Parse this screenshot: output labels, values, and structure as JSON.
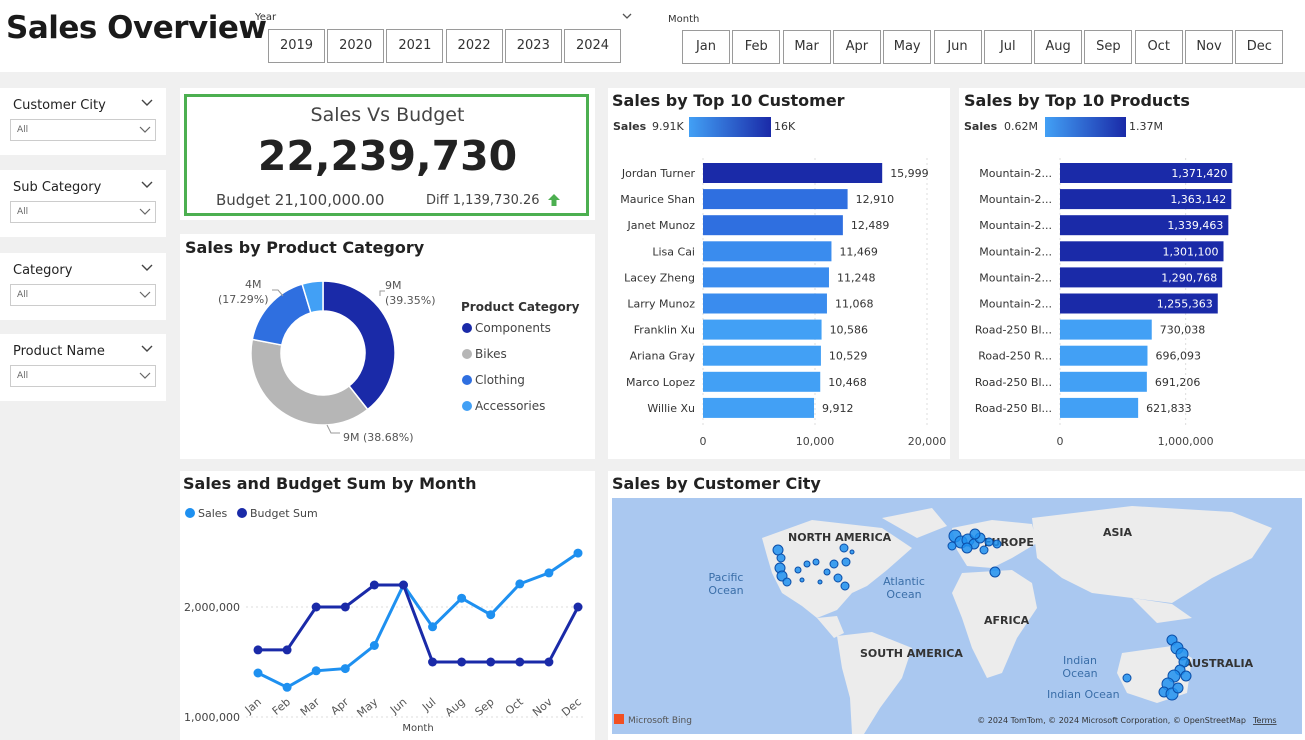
{
  "header": {
    "title": "Sales Overview"
  },
  "year_slicer": {
    "label": "Year",
    "options": [
      "2019",
      "2020",
      "2021",
      "2022",
      "2023",
      "2024"
    ]
  },
  "month_slicer": {
    "label": "Month",
    "options": [
      "Jan",
      "Feb",
      "Mar",
      "Apr",
      "May",
      "Jun",
      "Jul",
      "Aug",
      "Sep",
      "Oct",
      "Nov",
      "Dec"
    ]
  },
  "filters": [
    {
      "title": "Customer City",
      "value": "All"
    },
    {
      "title": "Sub Category",
      "value": "All"
    },
    {
      "title": "Category",
      "value": "All"
    },
    {
      "title": "Product Name",
      "value": "All"
    }
  ],
  "kpi": {
    "title": "Sales Vs Budget",
    "value": "22,239,730",
    "budget": "Budget 21,100,000.00",
    "diff": "Diff 1,139,730.26",
    "accent": "#4caf50"
  },
  "colors": {
    "dark_blue": "#1a2aa8",
    "mid_blue": "#2f6fe0",
    "light_blue": "#42a0f5",
    "grey": "#b6b6b6",
    "line_sales": "#1e90f0",
    "line_budget": "#1a2aa8"
  },
  "chart_data": [
    {
      "type": "pie",
      "title": "Sales by Product Category",
      "legend_title": "Product Category",
      "categories": [
        "Components",
        "Bikes",
        "Clothing",
        "Accessories"
      ],
      "values": [
        9,
        9,
        4,
        0.9
      ],
      "data_labels": [
        "9M\n(39.35%)",
        "9M (38.68%)",
        "4M\n(17.29%)",
        ""
      ],
      "percentages": [
        39.35,
        38.68,
        17.29,
        4.68
      ],
      "colors": [
        "#1a2aa8",
        "#b6b6b6",
        "#2f6fe0",
        "#42a0f5"
      ],
      "legend_position": "right"
    },
    {
      "type": "bar",
      "title": "Sales by Top 10 Customer",
      "gradient_label": "Sales",
      "gradient_min": "9.91K",
      "gradient_max": "16K",
      "categories": [
        "Jordan Turner",
        "Maurice Shan",
        "Janet Munoz",
        "Lisa Cai",
        "Lacey Zheng",
        "Larry Munoz",
        "Franklin Xu",
        "Ariana Gray",
        "Marco Lopez",
        "Willie Xu"
      ],
      "values": [
        15999,
        12910,
        12489,
        11469,
        11248,
        11068,
        10586,
        10529,
        10468,
        9912
      ],
      "value_labels": [
        "15,999",
        "12,910",
        "12,489",
        "11,469",
        "11,248",
        "11,068",
        "10,586",
        "10,529",
        "10,468",
        "9,912"
      ],
      "xlim": [
        0,
        20000
      ],
      "x_ticks": [
        "0",
        "10,000",
        "20,000"
      ]
    },
    {
      "type": "bar",
      "title": "Sales by Top 10 Products",
      "gradient_label": "Sales",
      "gradient_min": "0.62M",
      "gradient_max": "1.37M",
      "categories": [
        "Mountain-2...",
        "Mountain-2...",
        "Mountain-2...",
        "Mountain-2...",
        "Mountain-2...",
        "Mountain-2...",
        "Road-250 Bl...",
        "Road-250 R...",
        "Road-250 Bl...",
        "Road-250 Bl..."
      ],
      "values": [
        1371420,
        1363142,
        1339463,
        1301100,
        1290768,
        1255363,
        730038,
        696093,
        691206,
        621833
      ],
      "value_labels": [
        "1,371,420",
        "1,363,142",
        "1,339,463",
        "1,301,100",
        "1,290,768",
        "1,255,363",
        "730,038",
        "696,093",
        "691,206",
        "621,833"
      ],
      "xlim": [
        0,
        1500000
      ],
      "x_ticks": [
        "0",
        "1,000,000"
      ]
    },
    {
      "type": "line",
      "title": "Sales and Budget Sum by Month",
      "xlabel": "Month",
      "categories": [
        "Jan",
        "Feb",
        "Mar",
        "Apr",
        "May",
        "Jun",
        "Jul",
        "Aug",
        "Sep",
        "Oct",
        "Nov",
        "Dec"
      ],
      "series": [
        {
          "name": "Sales",
          "values": [
            1400000,
            1270000,
            1420000,
            1440000,
            1650000,
            2200000,
            1820000,
            2080000,
            1930000,
            2210000,
            2310000,
            2490000
          ]
        },
        {
          "name": "Budget Sum",
          "values": [
            1610000,
            1610000,
            2000000,
            2000000,
            2200000,
            2200000,
            1500000,
            1500000,
            1500000,
            1500000,
            1500000,
            2000000
          ]
        }
      ],
      "ylim": [
        1000000,
        2600000
      ],
      "y_ticks": [
        "2,000,000",
        "1,000,000"
      ],
      "legend_position": "top-left"
    }
  ],
  "map": {
    "title": "Sales by Customer City",
    "labels": [
      "NORTH AMERICA",
      "EUROPE",
      "ASIA",
      "Pacific Ocean",
      "Atlantic Ocean",
      "AFRICA",
      "SOUTH AMERICA",
      "Indian Ocean",
      "Indian Ocean",
      "AUSTRALIA"
    ],
    "bing": "Microsoft Bing",
    "copyright": "© 2024 TomTom, © 2024 Microsoft Corporation, © OpenStreetMap",
    "terms": "Terms"
  }
}
